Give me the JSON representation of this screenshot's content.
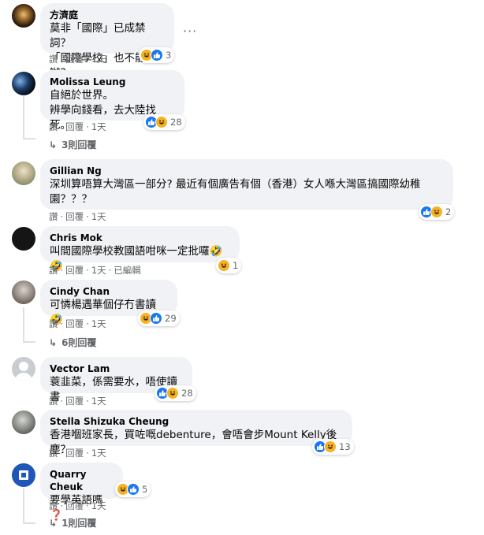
{
  "comments": [
    {
      "author": "方濟庭",
      "text": "莫非「國際」已成禁詞？\n「國際學校」也不能辦？",
      "actions": [
        "讚",
        "回覆",
        "1天"
      ],
      "reactions": [
        "haha",
        "like"
      ],
      "count": "3",
      "more_label": "···"
    },
    {
      "author": "Molissa Leung",
      "text": "自絕於世界。\n辨學向錢看，去大陸找死。",
      "actions": [
        "讚",
        "回覆",
        "1天"
      ],
      "reactions": [
        "like",
        "haha"
      ],
      "count": "28",
      "replies": "3則回覆"
    },
    {
      "author": "Gillian Ng",
      "text": "深圳算唔算大灣區一部分? 最近有個廣告有個（香港）女人喺大灣區搞國際幼稚\n園？？？",
      "actions": [
        "讚",
        "回覆",
        "1天"
      ],
      "reactions": [
        "like",
        "haha"
      ],
      "count": "2"
    },
    {
      "author": "Chris Mok",
      "text": "叫間國際學校教國語咁咪一定批囉🤣🤣",
      "actions": [
        "讚",
        "回覆",
        "1天",
        "已編輯"
      ],
      "reactions": [
        "haha"
      ],
      "count": "1"
    },
    {
      "author": "Cindy Chan",
      "text": "可憐楊遇華個仔冇書讀 🤣",
      "actions": [
        "讚",
        "回覆",
        "1天"
      ],
      "reactions": [
        "haha",
        "like"
      ],
      "count": "29",
      "replies": "6則回覆"
    },
    {
      "author": "Vector Lam",
      "text": "蓑韭菜，係需要水，唔使讀書",
      "actions": [
        "讚",
        "回覆",
        "1天"
      ],
      "reactions": [
        "like",
        "haha"
      ],
      "count": "28"
    },
    {
      "author": "Stella Shizuka Cheung",
      "text": "香港嗰班家長，買咗嘅debenture，會唔會步Mount Kelly後塵？",
      "actions": [
        "讚",
        "回覆",
        "1天"
      ],
      "reactions": [
        "like",
        "haha"
      ],
      "count": "13"
    },
    {
      "author": "Quarry Cheuk",
      "text": "要學英語嗎❓",
      "actions": [
        "讚",
        "回覆",
        "1天"
      ],
      "reactions": [
        "haha",
        "like"
      ],
      "count": "5",
      "replies": "1則回覆"
    }
  ],
  "colors": {
    "bubble": "#f0f2f5",
    "secondary_text": "#65676b",
    "like_blue": "#1877f2",
    "haha_yellow": "#f7b125"
  }
}
